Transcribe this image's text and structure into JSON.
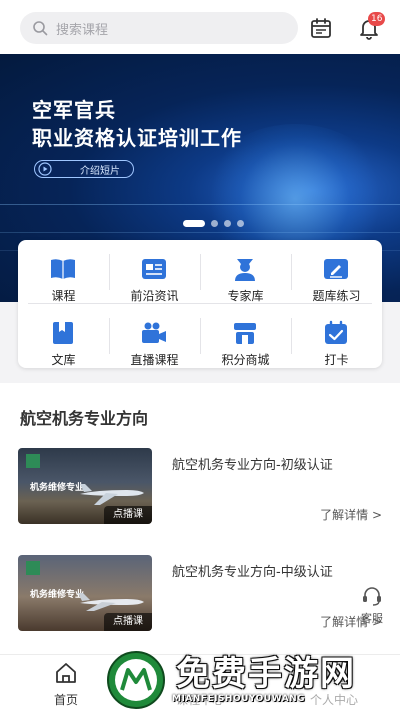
{
  "header": {
    "search_placeholder": "搜索课程",
    "notification_count": "16",
    "icons": {
      "search": "search-icon",
      "calendar": "calendar-icon",
      "bell": "bell-icon"
    }
  },
  "banner": {
    "title_line1": "空军官兵",
    "title_line2": "职业资格认证培训工作",
    "video_label": "介绍短片",
    "slide_count": 4,
    "active_slide": 1
  },
  "menu": {
    "items": [
      {
        "label": "课程",
        "icon": "book-icon"
      },
      {
        "label": "前沿资讯",
        "icon": "news-icon"
      },
      {
        "label": "专家库",
        "icon": "expert-icon"
      },
      {
        "label": "题库练习",
        "icon": "edit-icon"
      },
      {
        "label": "文库",
        "icon": "library-icon"
      },
      {
        "label": "直播课程",
        "icon": "camera-icon"
      },
      {
        "label": "积分商城",
        "icon": "shop-icon"
      },
      {
        "label": "打卡",
        "icon": "checkin-icon"
      }
    ],
    "accent_color": "#2f73d9"
  },
  "section": {
    "title": "航空机务专业方向",
    "courses": [
      {
        "thumb_text": "机务维修专业",
        "tag": "点播课",
        "title": "航空机务专业方向-初级认证",
        "more": "了解详情 >"
      },
      {
        "thumb_text": "机务维修专业",
        "tag": "点播课",
        "title": "航空机务专业方向-中级认证",
        "more": "了解详情 >"
      }
    ]
  },
  "service": {
    "label": "客服",
    "icon": "headset-icon"
  },
  "nav": {
    "items": [
      {
        "label": "首页",
        "icon": "home-icon"
      },
      {
        "label": "课程中心",
        "icon": "course-icon"
      },
      {
        "label": "个人中心",
        "icon": "user-icon"
      }
    ]
  },
  "watermark": {
    "title": "免费手游网",
    "subtitle": "MIANFEISHOUYOUWANG"
  }
}
